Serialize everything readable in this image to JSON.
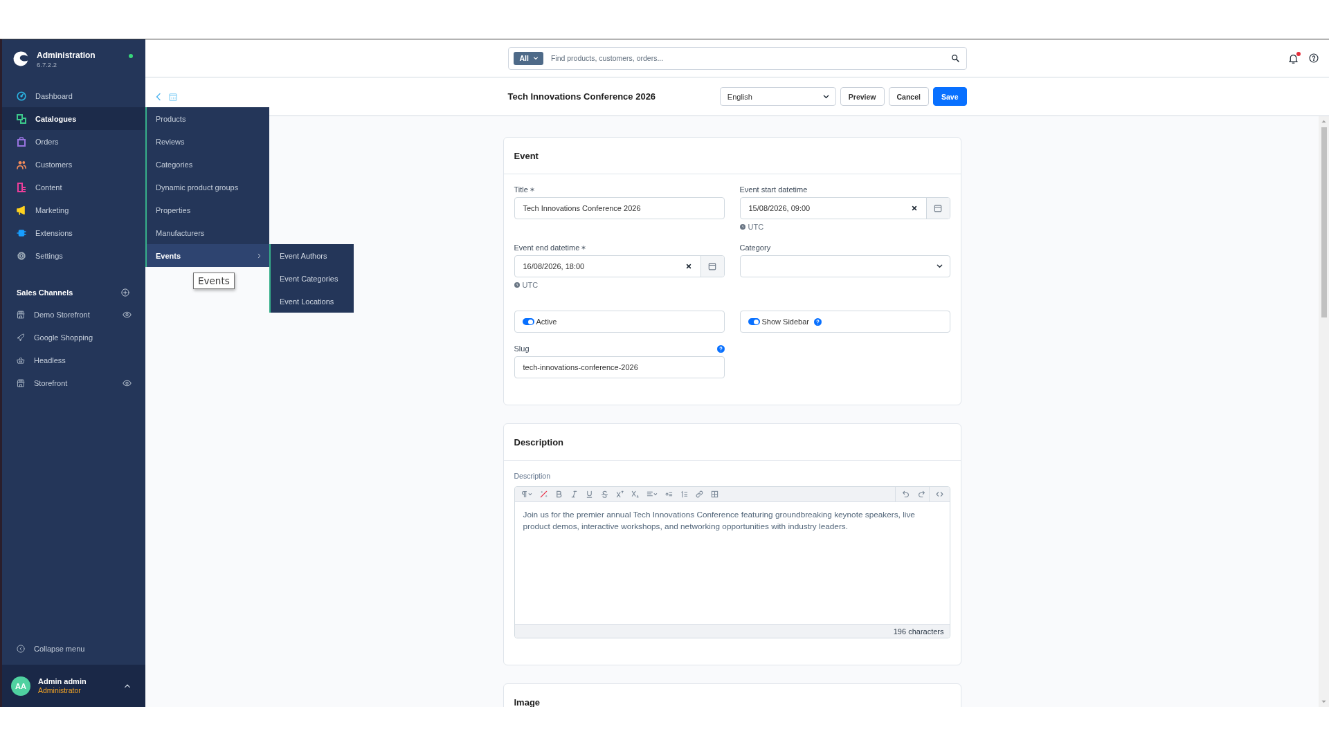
{
  "sidebar": {
    "brand": {
      "title": "Administration",
      "version": "6.7.2.2",
      "online": true
    },
    "nav": [
      {
        "label": "Dashboard",
        "color": "#2bb5e3",
        "selected": false
      },
      {
        "label": "Catalogues",
        "color": "#3cc98b",
        "selected": true
      },
      {
        "label": "Orders",
        "color": "#9874e0",
        "selected": false
      },
      {
        "label": "Customers",
        "color": "#f58c5a",
        "selected": false
      },
      {
        "label": "Content",
        "color": "#ee3e9b",
        "selected": false
      },
      {
        "label": "Marketing",
        "color": "#ffd21f",
        "selected": false
      },
      {
        "label": "Extensions",
        "color": "#189eff",
        "selected": false
      },
      {
        "label": "Settings",
        "color": "#9aa8b5",
        "selected": false
      }
    ],
    "sales_channels": {
      "title": "Sales Channels",
      "items": [
        {
          "label": "Demo Storefront",
          "preview": true
        },
        {
          "label": "Google Shopping",
          "preview": false
        },
        {
          "label": "Headless",
          "preview": false
        },
        {
          "label": "Storefront",
          "preview": true
        }
      ]
    },
    "collapse_label": "Collapse menu",
    "user": {
      "initials": "AA",
      "name": "Admin admin",
      "role": "Administrator"
    }
  },
  "flyout": {
    "items": [
      {
        "label": "Products",
        "selected": false
      },
      {
        "label": "Reviews",
        "selected": false
      },
      {
        "label": "Categories",
        "selected": false
      },
      {
        "label": "Dynamic product groups",
        "selected": false
      },
      {
        "label": "Properties",
        "selected": false
      },
      {
        "label": "Manufacturers",
        "selected": false
      },
      {
        "label": "Events",
        "selected": true,
        "children": [
          {
            "label": "Event Authors"
          },
          {
            "label": "Event Categories"
          },
          {
            "label": "Event Locations"
          }
        ]
      }
    ]
  },
  "tooltip": {
    "text": "Events"
  },
  "topbar": {
    "search": {
      "scope": "All",
      "placeholder": "Find products, customers, orders..."
    },
    "notifications_unread": true
  },
  "header": {
    "title": "Tech Innovations Conference 2026",
    "language": "English",
    "buttons": [
      {
        "label": "Preview",
        "kind": "secondary"
      },
      {
        "label": "Cancel",
        "kind": "secondary"
      },
      {
        "label": "Save",
        "kind": "primary"
      }
    ]
  },
  "cards": [
    {
      "title": "Event",
      "fields": [
        {
          "kind": "text",
          "label": "Title",
          "required": true,
          "help": false,
          "value": "Tech Innovations Conference 2026"
        },
        {
          "kind": "datetime",
          "label": "Event start datetime",
          "required": false,
          "help": false,
          "value": "15/08/2026, 09:00",
          "timezone": "UTC"
        },
        {
          "kind": "datetime",
          "label": "Event end datetime",
          "required": true,
          "help": false,
          "value": "16/08/2026, 18:00",
          "timezone": "UTC"
        },
        {
          "kind": "select",
          "label": "Category",
          "required": false,
          "help": false
        },
        {
          "kind": "switch",
          "label": "Active",
          "on": true,
          "help": false
        },
        {
          "kind": "switch",
          "label": "Show Sidebar",
          "on": true,
          "help": true
        },
        {
          "kind": "text",
          "label": "Slug",
          "required": false,
          "help": true,
          "value": "tech-innovations-conference-2026"
        }
      ]
    },
    {
      "title": "Description",
      "fields": [
        {
          "kind": "editor",
          "label": "Description",
          "required": false,
          "help": false,
          "value": "Join us for the premier annual Tech Innovations Conference featuring groundbreaking keynote speakers, live product demos, interactive workshops, and networking opportunities with industry leaders.",
          "counter": "196 characters"
        }
      ]
    },
    {
      "title": "Image"
    }
  ]
}
